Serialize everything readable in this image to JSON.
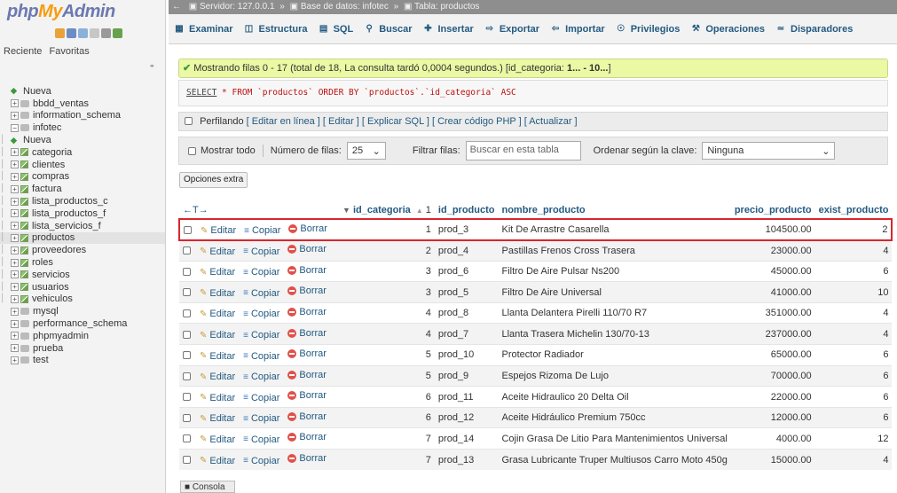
{
  "app": {
    "logo_php": "php",
    "logo_my": "My",
    "logo_admin": "Admin"
  },
  "left": {
    "recent_label": "Reciente",
    "favorites_label": "Favoritas",
    "tree": [
      {
        "label": "Nueva",
        "kind": "new",
        "level": 0
      },
      {
        "label": "bbdd_ventas",
        "kind": "db",
        "level": 0
      },
      {
        "label": "information_schema",
        "kind": "db",
        "level": 0
      },
      {
        "label": "infotec",
        "kind": "db-open",
        "level": 0
      },
      {
        "label": "Nueva",
        "kind": "new",
        "level": 1
      },
      {
        "label": "categoria",
        "kind": "table",
        "level": 1
      },
      {
        "label": "clientes",
        "kind": "table",
        "level": 1
      },
      {
        "label": "compras",
        "kind": "table",
        "level": 1
      },
      {
        "label": "factura",
        "kind": "table",
        "level": 1
      },
      {
        "label": "lista_productos_c",
        "kind": "table",
        "level": 1
      },
      {
        "label": "lista_productos_f",
        "kind": "table",
        "level": 1
      },
      {
        "label": "lista_servicios_f",
        "kind": "table",
        "level": 1
      },
      {
        "label": "productos",
        "kind": "table",
        "level": 1,
        "selected": true
      },
      {
        "label": "proveedores",
        "kind": "table",
        "level": 1
      },
      {
        "label": "roles",
        "kind": "table",
        "level": 1
      },
      {
        "label": "servicios",
        "kind": "table",
        "level": 1
      },
      {
        "label": "usuarios",
        "kind": "table",
        "level": 1
      },
      {
        "label": "vehiculos",
        "kind": "table",
        "level": 1
      },
      {
        "label": "mysql",
        "kind": "db",
        "level": 0
      },
      {
        "label": "performance_schema",
        "kind": "db",
        "level": 0
      },
      {
        "label": "phpmyadmin",
        "kind": "db",
        "level": 0
      },
      {
        "label": "prueba",
        "kind": "db",
        "level": 0
      },
      {
        "label": "test",
        "kind": "db",
        "level": 0
      }
    ]
  },
  "breadcrumb": {
    "server": "Servidor: 127.0.0.1",
    "database": "Base de datos: infotec",
    "table": "Tabla: productos"
  },
  "tabs": [
    {
      "label": "Examinar",
      "icon": "browse-icon"
    },
    {
      "label": "Estructura",
      "icon": "structure-icon"
    },
    {
      "label": "SQL",
      "icon": "sql-icon"
    },
    {
      "label": "Buscar",
      "icon": "search-icon"
    },
    {
      "label": "Insertar",
      "icon": "insert-icon"
    },
    {
      "label": "Exportar",
      "icon": "export-icon"
    },
    {
      "label": "Importar",
      "icon": "import-icon"
    },
    {
      "label": "Privilegios",
      "icon": "privileges-icon"
    },
    {
      "label": "Operaciones",
      "icon": "operations-icon"
    },
    {
      "label": "Disparadores",
      "icon": "triggers-icon"
    }
  ],
  "message": {
    "text": "Mostrando filas 0 - 17 (total de 18, La consulta tardó 0,0004 segundos.) [id_categoria: ",
    "range": "1... - 10...",
    "close": "]"
  },
  "sql": {
    "select": "SELECT",
    "rest": " * FROM `productos` ORDER BY `productos`.`id_categoria` ASC"
  },
  "profiling": {
    "label": "Perfilando",
    "links": "[ Editar en línea ] [ Editar ] [ Explicar SQL ] [ Crear código PHP ] [ Actualizar ]"
  },
  "filters": {
    "show_all": "Mostrar todo",
    "rows_label": "Número de filas:",
    "rows_value": "25",
    "filter_label": "Filtrar filas:",
    "filter_placeholder": "Buscar en esta tabla",
    "sort_label": "Ordenar según la clave:",
    "sort_value": "Ninguna"
  },
  "extra_options": "Opciones extra",
  "table": {
    "arrows": "←T→",
    "headers": {
      "id_categoria": "id_categoria",
      "sort_index": "1",
      "id_producto": "id_producto",
      "nombre_producto": "nombre_producto",
      "precio_producto": "precio_producto",
      "exist_producto": "exist_producto"
    },
    "actions": {
      "edit": "Editar",
      "copy": "Copiar",
      "delete": "Borrar"
    },
    "rows": [
      {
        "id_categoria": "1",
        "id_producto": "prod_3",
        "nombre": "Kit De Arrastre Casarella",
        "precio": "104500.00",
        "exist": "2"
      },
      {
        "id_categoria": "2",
        "id_producto": "prod_4",
        "nombre": "Pastillas Frenos Cross Trasera",
        "precio": "23000.00",
        "exist": "4"
      },
      {
        "id_categoria": "3",
        "id_producto": "prod_6",
        "nombre": "Filtro De Aire Pulsar Ns200",
        "precio": "45000.00",
        "exist": "6"
      },
      {
        "id_categoria": "3",
        "id_producto": "prod_5",
        "nombre": "Filtro De Aire Universal",
        "precio": "41000.00",
        "exist": "10"
      },
      {
        "id_categoria": "4",
        "id_producto": "prod_8",
        "nombre": "Llanta Delantera Pirelli 110/70 R7",
        "precio": "351000.00",
        "exist": "4"
      },
      {
        "id_categoria": "4",
        "id_producto": "prod_7",
        "nombre": "Llanta Trasera Michelin 130/70-13",
        "precio": "237000.00",
        "exist": "4"
      },
      {
        "id_categoria": "5",
        "id_producto": "prod_10",
        "nombre": "Protector Radiador",
        "precio": "65000.00",
        "exist": "6"
      },
      {
        "id_categoria": "5",
        "id_producto": "prod_9",
        "nombre": "Espejos Rizoma De Lujo",
        "precio": "70000.00",
        "exist": "6"
      },
      {
        "id_categoria": "6",
        "id_producto": "prod_11",
        "nombre": "Aceite Hidraulico 20 Delta Oil",
        "precio": "22000.00",
        "exist": "6"
      },
      {
        "id_categoria": "6",
        "id_producto": "prod_12",
        "nombre": "Aceite Hidráulico Premium 750cc",
        "precio": "12000.00",
        "exist": "6"
      },
      {
        "id_categoria": "7",
        "id_producto": "prod_14",
        "nombre": "Cojin Grasa De Litio Para Mantenimientos Universal",
        "precio": "4000.00",
        "exist": "12"
      },
      {
        "id_categoria": "7",
        "id_producto": "prod_13",
        "nombre": "Grasa Lubricante Truper Multiusos Carro Moto 450g",
        "precio": "15000.00",
        "exist": "4"
      }
    ]
  },
  "console": "Consola",
  "colors": {
    "accent_link": "#235a81",
    "highlight_border": "#d9262d",
    "success_bg": "#ebf8a4"
  }
}
